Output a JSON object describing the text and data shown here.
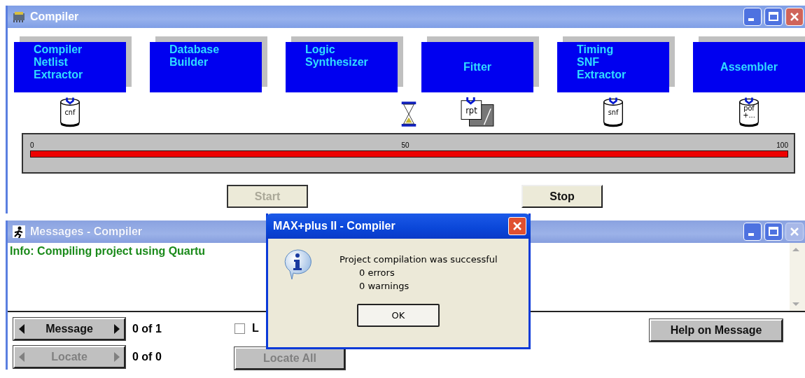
{
  "compiler_window": {
    "title": "Compiler",
    "active": true,
    "stages": [
      {
        "label": "Compiler\nNetlist\nExtractor",
        "output": {
          "kind": "database",
          "lines": [
            "cnf"
          ]
        },
        "running": false
      },
      {
        "label": "Database\nBuilder",
        "running": false
      },
      {
        "label": "Logic\nSynthesizer",
        "running": true
      },
      {
        "label": "Fitter",
        "output": {
          "kind": "report",
          "lines": [
            "rpt"
          ]
        },
        "running": false
      },
      {
        "label": "Timing\nSNF\nExtractor",
        "output": {
          "kind": "database",
          "lines": [
            "snf"
          ]
        },
        "running": false
      },
      {
        "label": "Assembler",
        "output": {
          "kind": "database",
          "lines": [
            "pof",
            "+..."
          ]
        },
        "running": false
      }
    ],
    "progress": {
      "level": 1.0,
      "ticks": [
        "0",
        "50",
        "100"
      ]
    },
    "buttons": [
      {
        "label": "Start",
        "disabled": true
      },
      {
        "label": "Stop",
        "disabled": false
      }
    ]
  },
  "messages_window": {
    "title": "Messages - Compiler",
    "active": false,
    "messages": [
      {
        "text": "Info: Compiling project using Quartu"
      }
    ],
    "message_nav": {
      "label": "Message",
      "disabled": false,
      "count": "0 of 1"
    },
    "locate_nav": {
      "label": "Locate",
      "disabled": true,
      "count": "0 of 0"
    },
    "checkbox": {
      "label": "L",
      "checked": false
    },
    "locate_all": {
      "label": "Locate All",
      "disabled": true
    },
    "help_button": {
      "label": "Help on Message",
      "disabled": false
    }
  },
  "dialog": {
    "title": "MAX+plus II - Compiler",
    "lines": [
      "Project compilation was successful",
      "0 errors",
      "0 warnings"
    ],
    "button": "OK"
  }
}
